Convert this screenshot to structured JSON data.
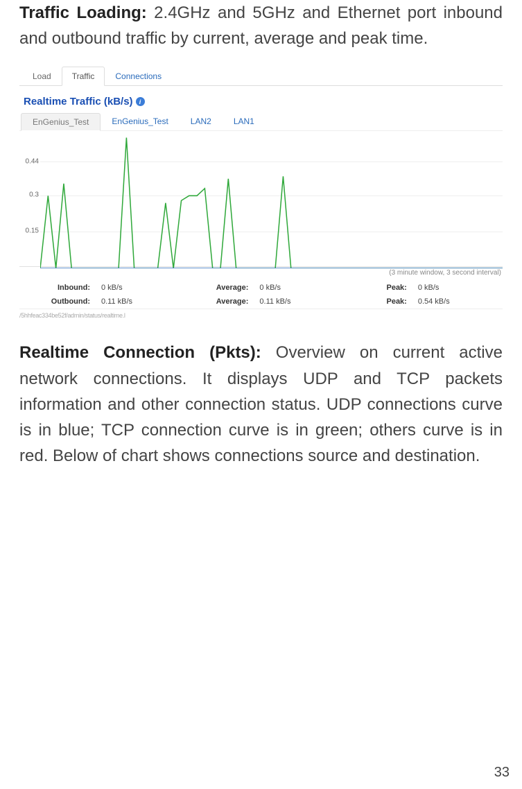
{
  "para1": {
    "bold": "Traffic Loading:",
    "text": " 2.4GHz and 5GHz and Ethernet port inbound and outbound traffic by current, average and peak time."
  },
  "tabs": {
    "items": [
      "Load",
      "Traffic",
      "Connections"
    ],
    "activeIndex": 1
  },
  "section": {
    "title": "Realtime Traffic (kB/s)"
  },
  "subtabs": {
    "items": [
      "EnGenius_Test",
      "EnGenius_Test",
      "LAN2",
      "LAN1"
    ],
    "activeIndex": 0
  },
  "chart_data": {
    "type": "line",
    "title": "Realtime Traffic (kB/s)",
    "xlabel": "",
    "ylabel": "",
    "ylim": [
      0,
      0.55
    ],
    "y_ticks": [
      0.15,
      0.3,
      0.44
    ],
    "window_note": "(3 minute window, 3 second interval)",
    "series": [
      {
        "name": "Inbound",
        "color": "#2a6bbb",
        "values": [
          0,
          0,
          0,
          0,
          0,
          0,
          0,
          0,
          0,
          0,
          0,
          0,
          0,
          0,
          0,
          0,
          0,
          0,
          0,
          0,
          0,
          0,
          0,
          0,
          0,
          0,
          0,
          0,
          0,
          0,
          0,
          0,
          0,
          0,
          0,
          0,
          0,
          0,
          0,
          0,
          0,
          0,
          0,
          0,
          0,
          0,
          0,
          0,
          0,
          0,
          0,
          0,
          0,
          0,
          0,
          0,
          0,
          0,
          0,
          0
        ]
      },
      {
        "name": "Outbound",
        "color": "#2fa83a",
        "values": [
          0,
          0.3,
          0,
          0.35,
          0,
          0,
          0,
          0,
          0,
          0,
          0,
          0.54,
          0,
          0,
          0,
          0,
          0.27,
          0,
          0.28,
          0.3,
          0.3,
          0.33,
          0,
          0,
          0.37,
          0,
          0,
          0,
          0,
          0,
          0,
          0.38,
          0,
          0,
          0,
          0,
          0,
          0,
          0,
          0,
          0,
          0,
          0,
          0,
          0,
          0,
          0,
          0,
          0,
          0,
          0,
          0,
          0,
          0,
          0,
          0,
          0,
          0,
          0,
          0
        ]
      }
    ]
  },
  "stats": {
    "rows": [
      {
        "label": "Inbound:",
        "current": "0 kB/s",
        "avg_label": "Average:",
        "average": "0 kB/s",
        "peak_label": "Peak:",
        "peak": "0 kB/s"
      },
      {
        "label": "Outbound:",
        "current": "0.11 kB/s",
        "avg_label": "Average:",
        "average": "0.11 kB/s",
        "peak_label": "Peak:",
        "peak": "0.54 kB/s"
      }
    ]
  },
  "footer_scrap": "/5hhfeac334be52f/admin/status/realtime.l",
  "para2": {
    "bold": "Realtime Connection (Pkts):",
    "text": " Overview on current active network connections. It displays UDP and TCP packets information and other connection status. UDP connections curve is in blue; TCP connection curve is in green; others curve is in red. Below of chart shows connections source and destination."
  },
  "page_number": "33"
}
